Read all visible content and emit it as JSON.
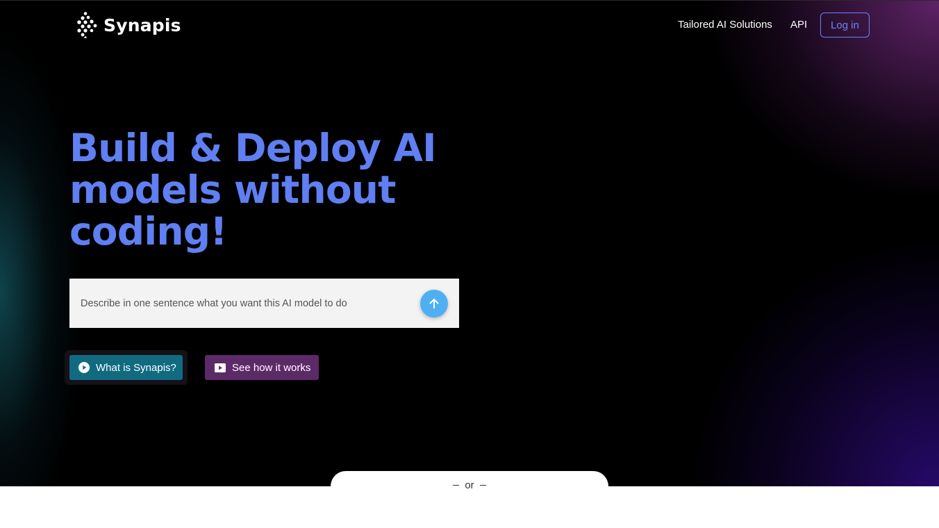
{
  "brand": {
    "name": "Synapis",
    "logo_icon": "synapis-dots-logo"
  },
  "nav": {
    "links": [
      {
        "label": "Tailored AI Solutions"
      },
      {
        "label": "API"
      }
    ],
    "login_label": "Log in"
  },
  "hero": {
    "headline": "Build & Deploy AI models without coding!",
    "prompt_placeholder": "Describe in one sentence what you want this AI model to do",
    "send_icon": "arrow-up-icon",
    "what_button": {
      "label": "What is Synapis?",
      "icon": "play-circle-icon"
    },
    "see_button": {
      "label": "See how it works",
      "icon": "video-play-icon"
    }
  },
  "divider": {
    "label": "or"
  },
  "colors": {
    "headline": "#5f7ff2",
    "login_border": "#6b86f6",
    "send_button": "#4eb0f3",
    "what_button": "#106b80",
    "see_button": "#5d2a68"
  }
}
